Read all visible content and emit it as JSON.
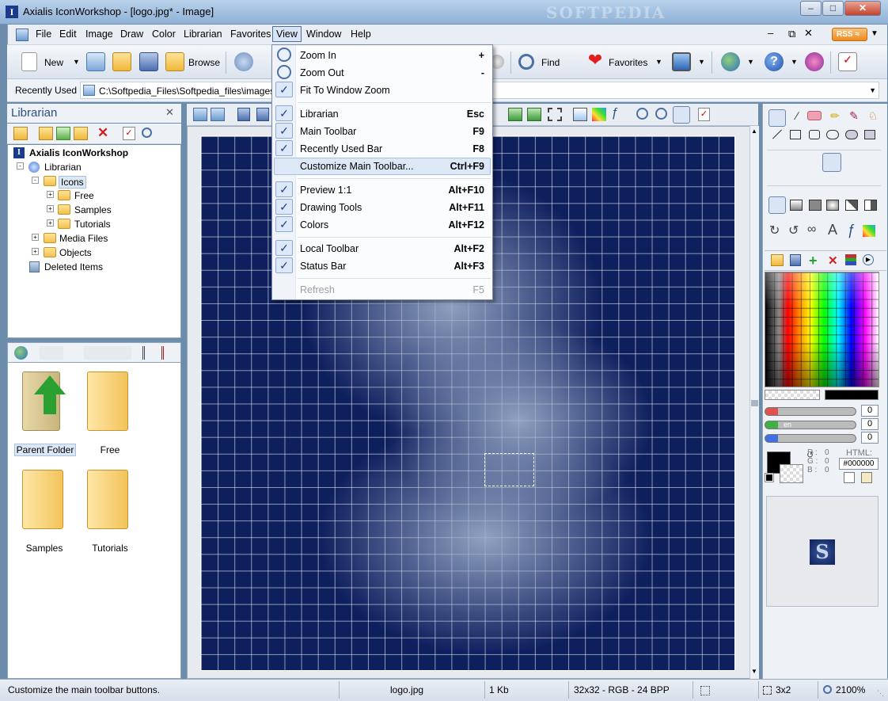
{
  "window": {
    "title": "Axialis IconWorkshop - [logo.jpg* - Image]",
    "app_icon": "I"
  },
  "menu": {
    "items": [
      "File",
      "Edit",
      "Image",
      "Draw",
      "Color",
      "Librarian",
      "Favorites",
      "View",
      "Window",
      "Help"
    ],
    "active": "View",
    "rss": "RSS"
  },
  "toolbar": {
    "new_label": "New",
    "browse_label": "Browse",
    "find_label": "Find",
    "favorites_label": "Favorites"
  },
  "recently_used": {
    "label": "Recently Used",
    "path": "C:\\Softpedia_Files\\Softpedia_files\\images"
  },
  "librarian": {
    "title": "Librarian",
    "tree": [
      {
        "label": "Axialis IconWorkshop",
        "level": 0,
        "bold": true
      },
      {
        "label": "Librarian",
        "level": 1
      },
      {
        "label": "Icons",
        "level": 2
      },
      {
        "label": "Free",
        "level": 3
      },
      {
        "label": "Samples",
        "level": 3
      },
      {
        "label": "Tutorials",
        "level": 3
      },
      {
        "label": "Media Files",
        "level": 2
      },
      {
        "label": "Objects",
        "level": 2
      },
      {
        "label": "Deleted Items",
        "level": 1
      }
    ],
    "thumbnails": [
      {
        "label": "Parent Folder"
      },
      {
        "label": "Free"
      },
      {
        "label": "Samples"
      },
      {
        "label": "Tutorials"
      }
    ]
  },
  "view_menu": {
    "items": [
      {
        "label": "Zoom In",
        "shortcut": "+",
        "icon": "zoom-in-icon"
      },
      {
        "label": "Zoom Out",
        "shortcut": "-",
        "icon": "zoom-out-icon"
      },
      {
        "label": "Fit To Window Zoom",
        "shortcut": "",
        "checked": true
      },
      {
        "label": "Librarian",
        "shortcut": "Esc",
        "checked": true
      },
      {
        "label": "Main Toolbar",
        "shortcut": "F9",
        "checked": true
      },
      {
        "label": "Recently Used Bar",
        "shortcut": "F8",
        "checked": true
      },
      {
        "label": "Customize Main Toolbar...",
        "shortcut": "Ctrl+F9",
        "highlighted": true
      },
      {
        "label": "Preview 1:1",
        "shortcut": "Alt+F10",
        "checked": true
      },
      {
        "label": "Drawing Tools",
        "shortcut": "Alt+F11",
        "checked": true
      },
      {
        "label": "Colors",
        "shortcut": "Alt+F12",
        "checked": true
      },
      {
        "label": "Local Toolbar",
        "shortcut": "Alt+F2",
        "checked": true
      },
      {
        "label": "Status Bar",
        "shortcut": "Alt+F3",
        "checked": true
      },
      {
        "label": "Refresh",
        "shortcut": "F5",
        "disabled": true
      }
    ]
  },
  "colors": {
    "sliders": [
      {
        "label": "",
        "value": "0"
      },
      {
        "label": "en",
        "value": "0"
      },
      {
        "label": "",
        "value": "0"
      }
    ],
    "rgb": {
      "r_label": "R :",
      "r": "0",
      "g_label": "G :",
      "g": "0",
      "b_label": "B :",
      "b": "0"
    },
    "html_label": "HTML:",
    "html_value": "#000000",
    "preview_letter": "S"
  },
  "status": {
    "message": "Customize the main toolbar buttons.",
    "file": "logo.jpg",
    "size": "1 Kb",
    "format": "32x32 - RGB - 24 BPP",
    "selection": "3x2",
    "zoom": "2100%"
  },
  "watermark": "SOFTPEDIA"
}
